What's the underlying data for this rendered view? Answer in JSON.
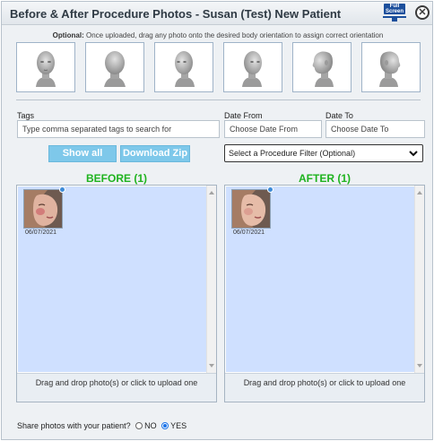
{
  "window": {
    "title": "Before & After Procedure Photos - Susan (Test) New Patient",
    "fullscreen_label": "Full Screen",
    "close_icon": "close-icon"
  },
  "orientation": {
    "hint_bold": "Optional:",
    "hint_text": " Once uploaded, drag any photo onto the desired body orientation to assign correct orientation",
    "items": [
      {
        "name": "head-front-icon"
      },
      {
        "name": "head-back-icon"
      },
      {
        "name": "head-left-three-quarter-icon"
      },
      {
        "name": "head-right-three-quarter-icon"
      },
      {
        "name": "head-left-profile-icon"
      },
      {
        "name": "head-right-profile-icon"
      }
    ]
  },
  "filters": {
    "tags_label": "Tags",
    "tags_placeholder": "Type comma separated tags to search for",
    "date_from_label": "Date From",
    "date_from_placeholder": "Choose Date From",
    "date_to_label": "Date To",
    "date_to_placeholder": "Choose Date To",
    "show_all": "Show all",
    "download_zip": "Download Zip",
    "procedure_filter": "Select a Procedure Filter (Optional)"
  },
  "before": {
    "heading": "BEFORE (1)",
    "photos": [
      {
        "date": "06/07/2021"
      }
    ],
    "upload_text": "Drag and drop photo(s) or click to upload one"
  },
  "after": {
    "heading": "AFTER (1)",
    "photos": [
      {
        "date": "06/07/2021"
      }
    ],
    "upload_text": "Drag and drop photo(s) or click to upload one"
  },
  "share": {
    "question": "Share photos with your patient?",
    "no_label": "NO",
    "yes_label": "YES",
    "selected": "YES"
  },
  "colors": {
    "heading_green": "#1fb31f",
    "button_blue": "#7ec8ea",
    "drop_blue": "#cfe0ff"
  }
}
